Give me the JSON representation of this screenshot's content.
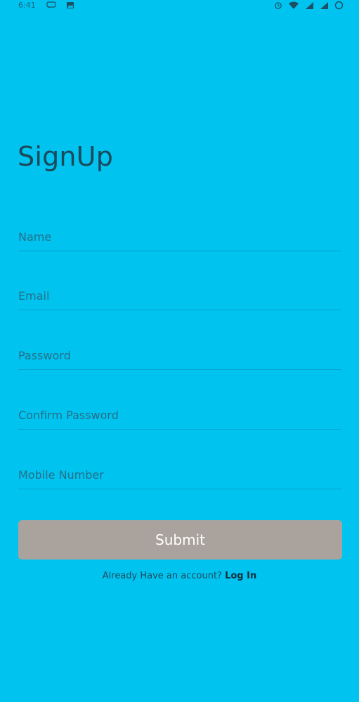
{
  "status_bar": {
    "time": "6:41",
    "left_icons": [
      "message-icon",
      "image-icon"
    ],
    "right_icons": [
      "alarm-icon",
      "wifi-icon",
      "signal-icon",
      "signal-icon",
      "battery-icon"
    ]
  },
  "header": {
    "title": "SignUp"
  },
  "form": {
    "name_placeholder": "Name",
    "email_placeholder": "Email",
    "password_placeholder": "Password",
    "confirm_password_placeholder": "Confirm Password",
    "mobile_placeholder": "Mobile Number",
    "submit_label": "Submit"
  },
  "footer": {
    "prompt_text": "Already Have an account?",
    "login_label": "Log In"
  },
  "colors": {
    "background": "#00C3F0",
    "title_text": "#1b4a5b",
    "button": "#AAA29D",
    "button_text": "#ffffff"
  }
}
